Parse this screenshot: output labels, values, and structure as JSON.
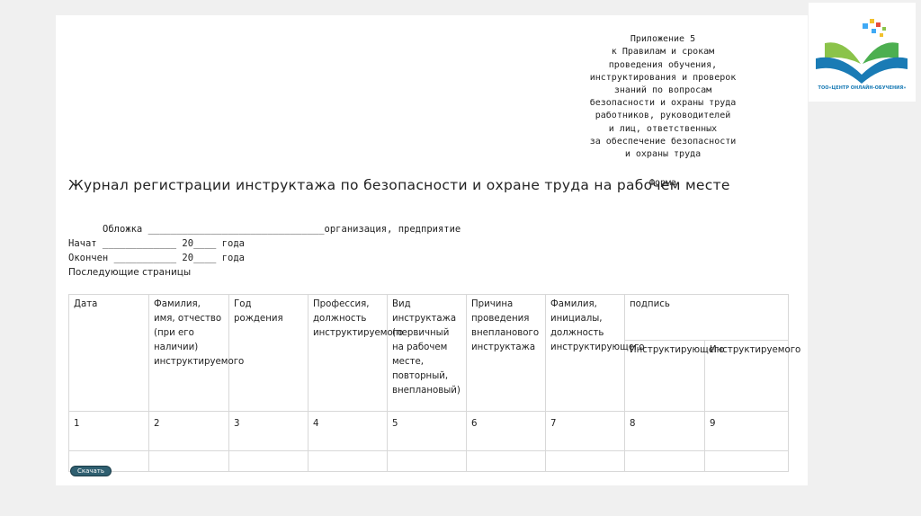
{
  "annex": {
    "text": "Приложение 5\nк Правилам и срокам\nпроведения обучения,\nинструктирования и проверок\nзнаний по вопросам\nбезопасности и охраны труда\nработников, руководителей\nи лиц, ответственных\nза обеспечение безопасности\nи охраны труда",
    "form_label": "Форма"
  },
  "title": "Журнал регистрации инструктажа по безопасности и охране труда на рабочем месте",
  "cover_line": "Обложка _______________________________организация, предприятие",
  "start_line": "Начат _____________ 20____ года",
  "end_line": "Окончен ___________ 20____ года",
  "next_pages": "Последующие страницы",
  "table": {
    "headers": [
      "Дата",
      "Фамилия, имя, отчество (при его наличии) инструктируемого",
      "Год рождения",
      "Профессия, должность инструктируемого",
      "Вид инструктажа (первичный на рабочем месте, повторный, внеплановый)",
      "Причина проведения внепланового инструктажа",
      "Фамилия, инициалы, должность инструктирующего",
      "подпись"
    ],
    "sub_headers": [
      "Инструктирующего",
      "Инструктируемого"
    ],
    "numbers": [
      "1",
      "2",
      "3",
      "4",
      "5",
      "6",
      "7",
      "8",
      "9"
    ]
  },
  "download_label": "Скачать",
  "logo": {
    "caption": "ТОО«ЦЕНТР ОНЛАЙН-ОБУЧЕНИЯ»",
    "colors": {
      "book": "#1a7bb5",
      "leaf": "#4caf50",
      "squares": [
        "#f2c12e",
        "#e74c3c",
        "#3fa9f5",
        "#8bc34a"
      ]
    }
  }
}
